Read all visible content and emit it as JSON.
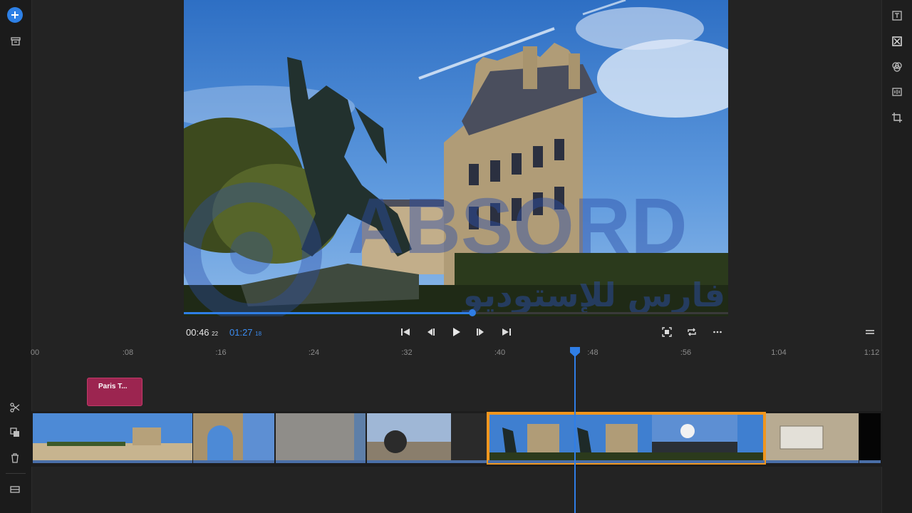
{
  "player": {
    "current_time_main": "00:46",
    "current_time_frames": "22",
    "total_time_main": "01:27",
    "total_time_frames": "18",
    "progress": 0.53
  },
  "timeline": {
    "ruler_labels": [
      "00",
      ":08",
      ":16",
      ":24",
      ":32",
      ":40",
      ":48",
      ":56",
      "1:04",
      "1:12"
    ],
    "title_clip_label": "Paris T...",
    "playhead_time": "00:46"
  },
  "watermark": {
    "latin_text": "ABSORD",
    "arabic_text": "فارس للإستوديو"
  },
  "colors": {
    "accent": "#2f7ee6",
    "selection": "#f0961e",
    "title_clip": "#9c2550",
    "background": "#232323"
  },
  "icons": {
    "left_rail": [
      "add-media-icon",
      "archive-icon",
      "scissors-icon",
      "duplicate-icon",
      "trash-icon",
      "track-icon"
    ],
    "right_rail": [
      "title-panel-icon",
      "transitions-icon",
      "color-icon",
      "audio-icon",
      "crop-icon"
    ],
    "transport": [
      "skip-to-start-icon",
      "step-back-icon",
      "play-icon",
      "step-forward-icon",
      "skip-to-end-icon",
      "fit-screen-icon",
      "loop-icon",
      "more-icon",
      "menu-icon"
    ]
  }
}
